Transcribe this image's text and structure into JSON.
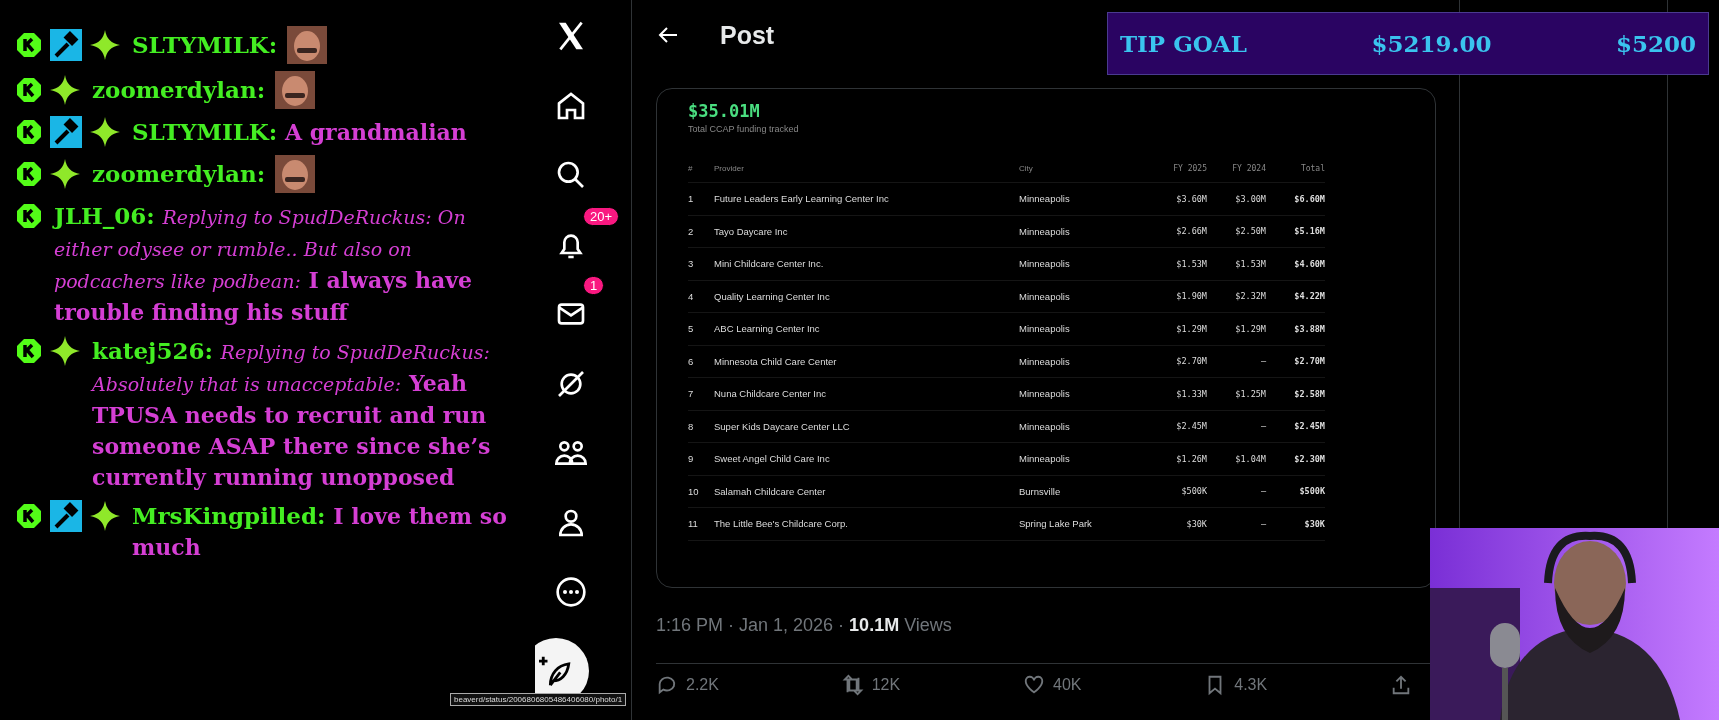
{
  "chat": {
    "messages": [
      {
        "badges": [
          {
            "kind": "kick"
          },
          {
            "kind": "moderator"
          },
          {
            "kind": "sparkle"
          }
        ],
        "username": "SLTYMILK:",
        "emote": true
      },
      {
        "badges": [
          {
            "kind": "kick"
          },
          {
            "kind": "sparkle"
          }
        ],
        "username": "zoomerdylan:",
        "emote": true
      },
      {
        "badges": [
          {
            "kind": "kick"
          },
          {
            "kind": "moderator"
          },
          {
            "kind": "sparkle"
          }
        ],
        "username": "SLTYMILK:",
        "text": "A grandmalian",
        "emote": false
      },
      {
        "badges": [
          {
            "kind": "kick"
          },
          {
            "kind": "sparkle"
          }
        ],
        "username": "zoomerdylan:",
        "emote": true
      },
      {
        "badges": [
          {
            "kind": "kick"
          }
        ],
        "username": "JLH_06:",
        "reply": "Replying to SpudDeRuckus: On either odysee or rumble.. But also on podcachers like podbean:",
        "text": "I always have trouble finding his stuff",
        "emote": false
      },
      {
        "badges": [
          {
            "kind": "kick"
          },
          {
            "kind": "sparkle"
          }
        ],
        "username": "katej526:",
        "reply": "Replying to SpudDeRuckus: Absolutely that is unacceptable:",
        "text": "Yeah TPUSA needs to recruit and run someone ASAP there since she’s currently running unopposed",
        "emote": false
      },
      {
        "badges": [
          {
            "kind": "kick"
          },
          {
            "kind": "moderator"
          },
          {
            "kind": "sparkle"
          }
        ],
        "username": "MrsKingpilled:",
        "text": "I love them so much",
        "emote": false
      }
    ]
  },
  "nav": {
    "items": [
      {
        "kind": "logo"
      },
      {
        "kind": "home"
      },
      {
        "kind": "search"
      },
      {
        "kind": "notifications",
        "badge": "20+"
      },
      {
        "kind": "messages",
        "badge": "1"
      },
      {
        "kind": "grok"
      },
      {
        "kind": "communities"
      },
      {
        "kind": "profile"
      },
      {
        "kind": "more"
      },
      {
        "kind": "compose"
      }
    ]
  },
  "post": {
    "title": "Post",
    "card": {
      "total": "$35.01M",
      "total_label": "Total CCAP funding tracked",
      "table": {
        "columns": [
          {
            "label": "#",
            "kind": "index"
          },
          {
            "label": "Provider",
            "kind": "text"
          },
          {
            "label": "City",
            "kind": "text"
          },
          {
            "label": "FY 2025",
            "kind": "money"
          },
          {
            "label": "FY 2024",
            "kind": "money"
          },
          {
            "label": "Total",
            "kind": "total"
          }
        ],
        "rows": [
          [
            "1",
            "Future Leaders Early Learning Center Inc",
            "Minneapolis",
            "$3.60M",
            "$3.00M",
            "$6.60M"
          ],
          [
            "2",
            "Tayo Daycare Inc",
            "Minneapolis",
            "$2.66M",
            "$2.50M",
            "$5.16M"
          ],
          [
            "3",
            "Mini Childcare Center Inc.",
            "Minneapolis",
            "$1.53M",
            "$1.53M",
            "$4.60M"
          ],
          [
            "4",
            "Quality Learning Center Inc",
            "Minneapolis",
            "$1.90M",
            "$2.32M",
            "$4.22M"
          ],
          [
            "5",
            "ABC Learning Center Inc",
            "Minneapolis",
            "$1.29M",
            "$1.29M",
            "$3.88M"
          ],
          [
            "6",
            "Minnesota Child Care Center",
            "Minneapolis",
            "$2.70M",
            "–",
            "$2.70M"
          ],
          [
            "7",
            "Nuna Childcare Center Inc",
            "Minneapolis",
            "$1.33M",
            "$1.25M",
            "$2.58M"
          ],
          [
            "8",
            "Super Kids Daycare Center LLC",
            "Minneapolis",
            "$2.45M",
            "–",
            "$2.45M"
          ],
          [
            "9",
            "Sweet Angel Child Care Inc",
            "Minneapolis",
            "$1.26M",
            "$1.04M",
            "$2.30M"
          ],
          [
            "10",
            "Salamah Childcare Center",
            "Burnsville",
            "$500K",
            "–",
            "$500K"
          ],
          [
            "11",
            "The Little Bee's Childcare Corp.",
            "Spring Lake Park",
            "$30K",
            "–",
            "$30K"
          ]
        ]
      }
    },
    "meta": {
      "time": "1:16 PM · Jan 1, 2026 ·",
      "views_count": "10.1M",
      "views_label": "Views"
    },
    "actions": [
      {
        "kind": "reply",
        "count": "2.2K"
      },
      {
        "kind": "repost",
        "count": "12K"
      },
      {
        "kind": "like",
        "count": "40K"
      },
      {
        "kind": "bookmark",
        "count": "4.3K"
      },
      {
        "kind": "share"
      }
    ]
  },
  "tip_goal": {
    "label": "TIP GOAL",
    "amount": "$5219.00",
    "goal": "$5200"
  },
  "status_url": "beaverd/status/2006806805486406080/photo/1"
}
